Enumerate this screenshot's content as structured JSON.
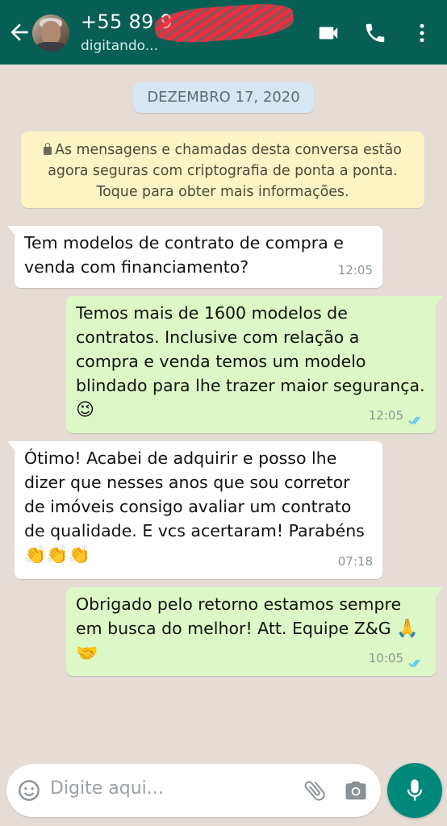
{
  "header": {
    "contact_name": "+55 89 9",
    "status": "digitando...",
    "icons": [
      "back-arrow-icon",
      "video-call-icon",
      "phone-icon",
      "more-vert-icon"
    ]
  },
  "date_chip": "DEZEMBRO 17, 2020",
  "encryption_notice": "As mensagens e chamadas desta conversa estão agora seguras com criptografia de ponta a ponta. Toque para obter mais informações.",
  "messages": [
    {
      "direction": "incoming",
      "text": "Tem modelos de contrato de compra e venda com financiamento?",
      "time": "12:05"
    },
    {
      "direction": "outgoing",
      "text": "Temos mais de 1600 modelos de contratos. Inclusive com relação a compra e venda temos um modelo blindado para lhe trazer maior segurança.",
      "emoji": "😉",
      "time": "12:05",
      "status": "read"
    },
    {
      "direction": "incoming",
      "text": "Ótimo! Acabei de adquirir e posso lhe dizer que nesses anos que sou corretor de imóveis consigo avaliar um contrato de qualidade. E vcs acertaram! Parabéns",
      "emoji": "👏👏👏",
      "time": "07:18"
    },
    {
      "direction": "outgoing",
      "text": "Obrigado pelo retorno estamos sempre em busca do melhor! Att. Equipe Z&G",
      "emoji": "🙏🤝",
      "time": "10:05",
      "status": "read"
    }
  ],
  "composer": {
    "placeholder": "Digite aqui...",
    "icons": [
      "emoji-icon",
      "attach-icon",
      "camera-icon",
      "mic-icon"
    ]
  },
  "colors": {
    "header": "#075e54",
    "chat_background": "#e5ddd5",
    "outgoing_bubble": "#dcf8c6",
    "incoming_bubble": "#ffffff",
    "read_ticks": "#4fc3f7",
    "mic_button": "#00897b"
  }
}
